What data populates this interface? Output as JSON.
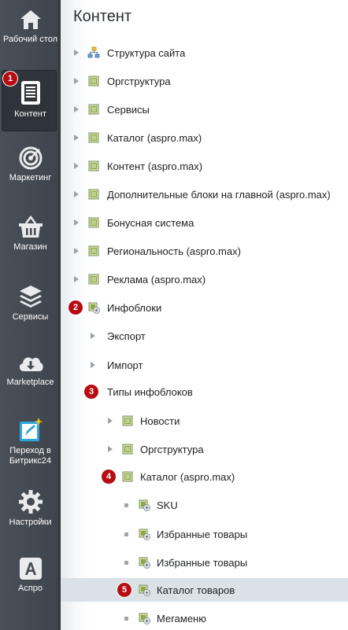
{
  "sidebar": {
    "items": [
      {
        "label": "Рабочий стол",
        "icon": "home-icon"
      },
      {
        "label": "Контент",
        "icon": "document-icon",
        "active": true,
        "badge": "1"
      },
      {
        "label": "Маркетинг",
        "icon": "target-icon"
      },
      {
        "label": "Магазин",
        "icon": "basket-icon"
      },
      {
        "label": "Сервисы",
        "icon": "layers-icon"
      },
      {
        "label": "Marketplace",
        "icon": "cloud-download-icon"
      },
      {
        "label": "Переход в Битрикс24",
        "icon": "bitrix24-icon"
      },
      {
        "label": "Настройки",
        "icon": "gear-icon"
      },
      {
        "label": "Аспро",
        "icon": "aspro-icon"
      }
    ]
  },
  "main": {
    "title": "Контент",
    "tree": [
      {
        "label": "Структура сайта",
        "icon": "sitemap-icon",
        "marker": "arrow"
      },
      {
        "label": "Оргструктура",
        "icon": "folder-icon",
        "marker": "arrow"
      },
      {
        "label": "Сервисы",
        "icon": "folder-icon",
        "marker": "arrow"
      },
      {
        "label": "Каталог (aspro.max)",
        "icon": "folder-icon",
        "marker": "arrow"
      },
      {
        "label": "Контент (aspro.max)",
        "icon": "folder-icon",
        "marker": "arrow"
      },
      {
        "label": "Дополнительные блоки на главной (aspro.max)",
        "icon": "folder-icon",
        "marker": "arrow"
      },
      {
        "label": "Бонусная система",
        "icon": "folder-icon",
        "marker": "arrow"
      },
      {
        "label": "Региональность (aspro.max)",
        "icon": "folder-icon",
        "marker": "arrow"
      },
      {
        "label": "Реклама (aspro.max)",
        "icon": "folder-icon",
        "marker": "arrow"
      },
      {
        "label": "Инфоблоки",
        "icon": "infoblock-icon",
        "badge": "2"
      },
      {
        "label": "Экспорт",
        "marker": "arrow"
      },
      {
        "label": "Импорт",
        "marker": "arrow"
      },
      {
        "label": "Типы инфоблоков",
        "badge": "3"
      },
      {
        "label": "Новости",
        "icon": "folder-icon",
        "marker": "arrow"
      },
      {
        "label": "Оргструктура",
        "icon": "folder-icon",
        "marker": "arrow"
      },
      {
        "label": "Каталог (aspro.max)",
        "icon": "folder-icon",
        "badge": "4"
      },
      {
        "label": "SKU",
        "icon": "infoblock-icon",
        "marker": "dot"
      },
      {
        "label": "Избранные товары",
        "icon": "infoblock-icon",
        "marker": "dot"
      },
      {
        "label": "Избранные товары",
        "icon": "infoblock-icon",
        "marker": "dot"
      },
      {
        "label": "Каталог товаров",
        "icon": "infoblock-icon",
        "badge": "5",
        "selected": true
      },
      {
        "label": "Мегаменю",
        "icon": "infoblock-icon",
        "marker": "dot"
      }
    ]
  },
  "colors": {
    "sidebar": "#454b52",
    "badge": "#b60c12",
    "selected_row": "#dae2e7"
  }
}
